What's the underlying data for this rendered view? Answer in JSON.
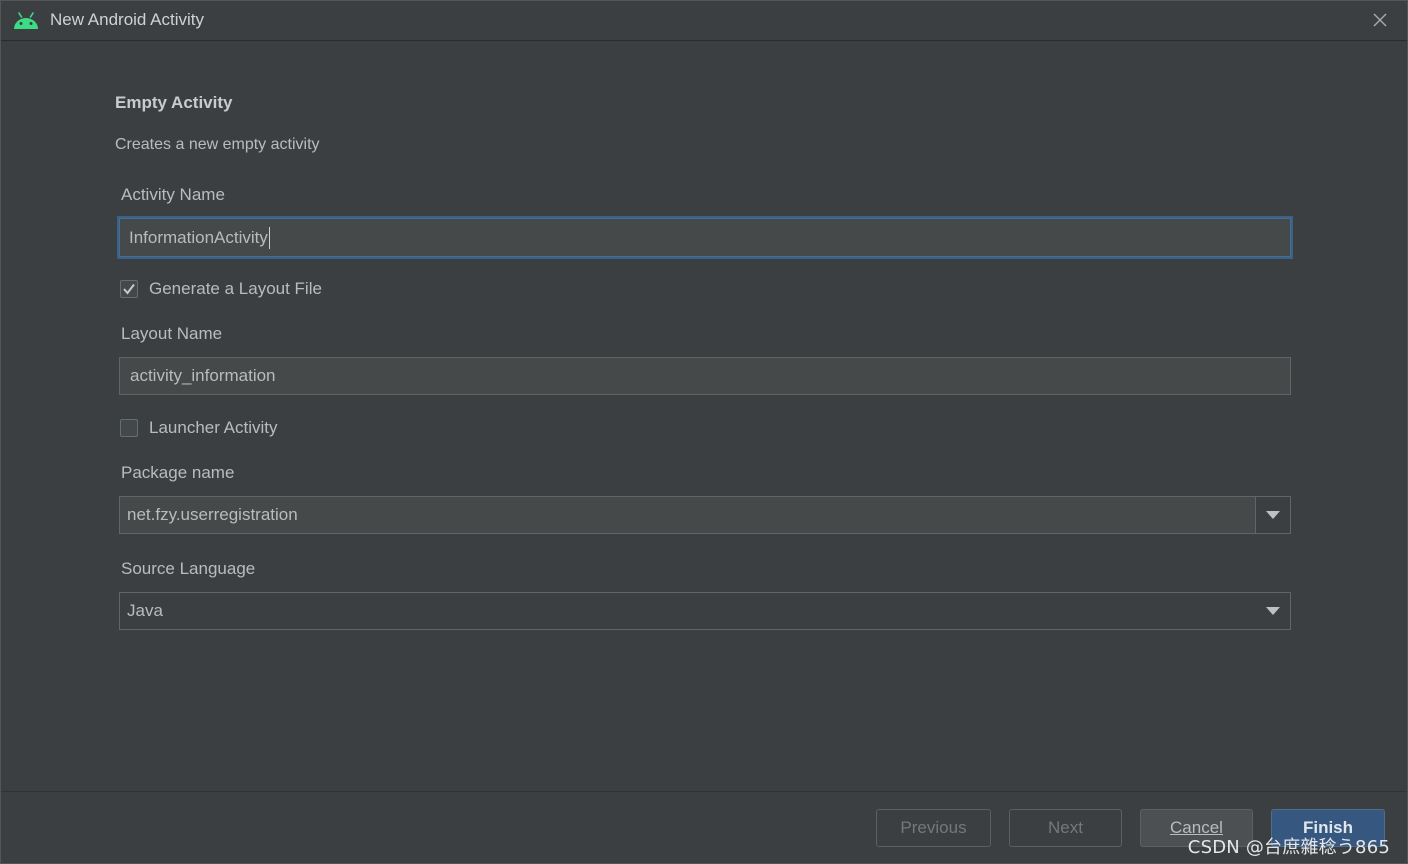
{
  "window": {
    "title": "New Android Activity"
  },
  "template": {
    "heading": "Empty Activity",
    "description": "Creates a new empty activity"
  },
  "form": {
    "activity_name_label": "Activity Name",
    "activity_name_value": "InformationActivity",
    "generate_layout_label": "Generate a Layout File",
    "generate_layout_checked": true,
    "layout_name_label": "Layout Name",
    "layout_name_value": "activity_information",
    "launcher_activity_label": "Launcher Activity",
    "launcher_activity_checked": false,
    "package_name_label": "Package name",
    "package_name_value": "net.fzy.userregistration",
    "source_language_label": "Source Language",
    "source_language_value": "Java"
  },
  "footer": {
    "previous_label": "Previous",
    "next_label": "Next",
    "cancel_label": "Cancel",
    "finish_label": "Finish"
  },
  "watermark": "CSDN @台庶雜稔う865",
  "colors": {
    "background": "#3c3f41",
    "field_background": "#45494a",
    "focus_border": "#3d6185",
    "finish_button": "#365880",
    "android_green": "#3ddc84"
  },
  "icons": {
    "app": "android-icon",
    "close": "close-icon",
    "check": "check-icon",
    "dropdown": "chevron-down-icon"
  }
}
